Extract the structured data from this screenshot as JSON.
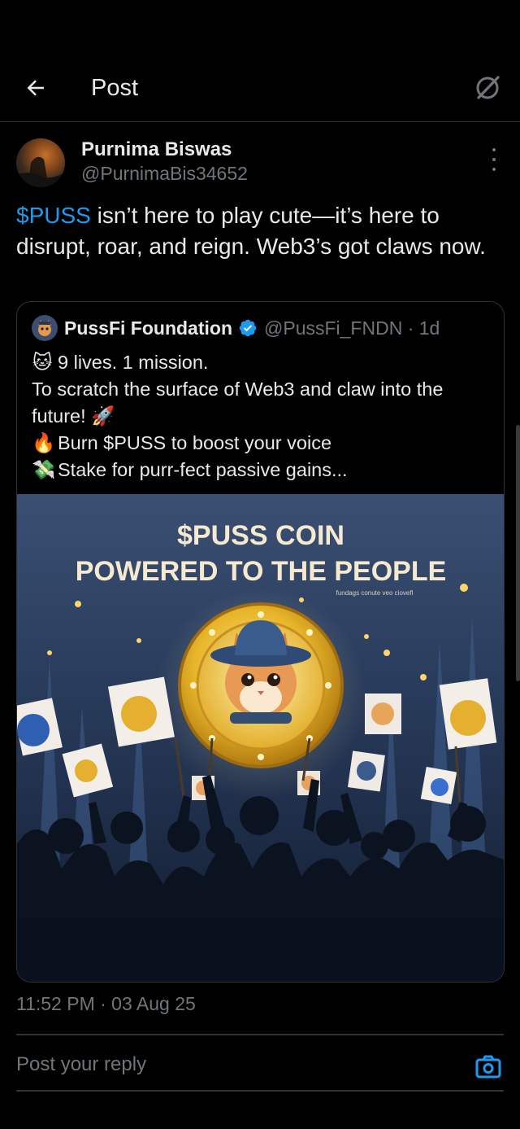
{
  "header": {
    "title": "Post"
  },
  "post": {
    "author_name": "Purnima Biswas",
    "author_handle": "@PurnimaBis34652",
    "cashtag": "$PUSS",
    "text_rest": " isn’t here to play cute—it’s here to disrupt, roar, and reign. Web3’s got claws now.",
    "timestamp": "11:52 PM · 03 Aug 25"
  },
  "quote": {
    "name": "PussFi Foundation",
    "handle_time": "@PussFi_FNDN · 1d",
    "lines": [
      "9 lives. 1 mission.",
      "To scratch the surface of Web3 and claw into the future!",
      "Burn $PUSS to boost your voice",
      "Stake for purr-fect passive gains..."
    ],
    "image": {
      "title_line1": "$PUSS COIN",
      "title_line2": "POWERED TO THE PEOPLE",
      "small_caption": "fundags conute veo ciovefl"
    }
  },
  "reply": {
    "placeholder": "Post your reply"
  },
  "icons": {
    "back": "arrow-left-icon",
    "grok": "grok-icon",
    "more": "more-vertical-icon",
    "verified": "verified-badge-icon",
    "camera": "camera-icon"
  },
  "colors": {
    "accent": "#1d9bf0",
    "muted": "#71767b",
    "border": "#2f3336"
  }
}
